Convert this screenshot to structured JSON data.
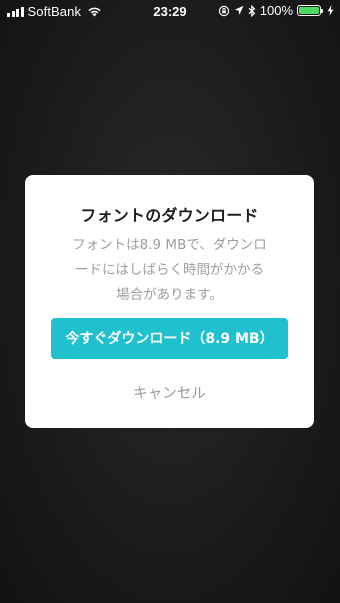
{
  "status_bar": {
    "carrier": "SoftBank",
    "time": "23:29",
    "battery_percent": "100%",
    "battery_level": 1.0,
    "battery_color": "#4cd964",
    "icons": [
      "signal-icon",
      "wifi-icon",
      "orientation-lock-icon",
      "location-icon",
      "bluetooth-icon",
      "battery-icon",
      "charging-icon"
    ]
  },
  "dialog": {
    "title": "フォントのダウンロード",
    "message_lines": [
      "フォントは8.9 MBで、ダウンロ",
      "ードにはしばらく時間がかかる",
      "場合があります。"
    ],
    "download_label": "今すぐダウンロード（8.9 MB）",
    "cancel_label": "キャンセル"
  },
  "colors": {
    "accent": "#21c0cf",
    "dialog_background": "#ffffff",
    "overlay_background": "#1c1c1c"
  }
}
